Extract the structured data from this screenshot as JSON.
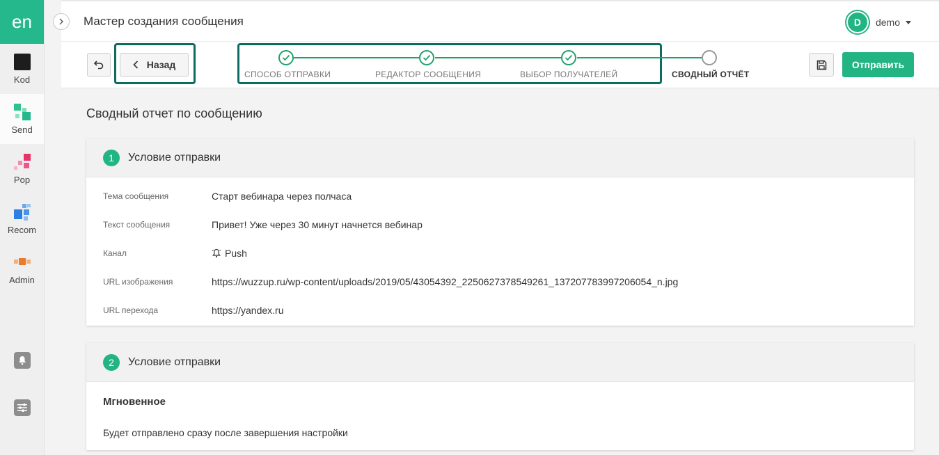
{
  "sidebar": {
    "logo": "en",
    "items": [
      {
        "label": "Kod",
        "icon": "kod-icon"
      },
      {
        "label": "Send",
        "icon": "send-icon"
      },
      {
        "label": "Pop",
        "icon": "pop-icon"
      },
      {
        "label": "Recom",
        "icon": "recom-icon"
      },
      {
        "label": "Admin",
        "icon": "admin-icon"
      }
    ],
    "bottom_icons": [
      "bell-icon",
      "sliders-icon"
    ]
  },
  "header": {
    "title": "Мастер создания сообщения",
    "user": {
      "initial": "D",
      "name": "demo"
    }
  },
  "toolbar": {
    "back_label": "Назад",
    "send_label": "Отправить",
    "steps": [
      {
        "label": "СПОСОБ ОТПРАВКИ",
        "state": "done"
      },
      {
        "label": "РЕДАКТОР СООБЩЕНИЯ",
        "state": "done"
      },
      {
        "label": "ВЫБОР ПОЛУЧАТЕЛЕЙ",
        "state": "done"
      },
      {
        "label": "СВОДНЫЙ ОТЧЁТ",
        "state": "current"
      }
    ]
  },
  "main": {
    "title": "Сводный отчет по сообщению",
    "card1": {
      "number": "1",
      "title": "Условие отправки",
      "rows": [
        {
          "label": "Тема сообщения",
          "value": "Старт вебинара через полчаса"
        },
        {
          "label": "Текст сообщения",
          "value": "Привет! Уже через 30 минут начнется вебинар"
        },
        {
          "label": "Канал",
          "value": "Push"
        },
        {
          "label": "URL изображения",
          "value": "https://wuzzup.ru/wp-content/uploads/2019/05/43054392_2250627378549261_1372077839972060​54_n.jpg"
        },
        {
          "label": "URL перехода",
          "value": "https://yandex.ru"
        }
      ]
    },
    "card2": {
      "number": "2",
      "title": "Условие отправки",
      "schedule_title": "Мгновенное",
      "schedule_desc": "Будет отправлено сразу после завершения настройки"
    }
  },
  "colors": {
    "accent": "#23b484",
    "frame": "#0f6b62"
  }
}
